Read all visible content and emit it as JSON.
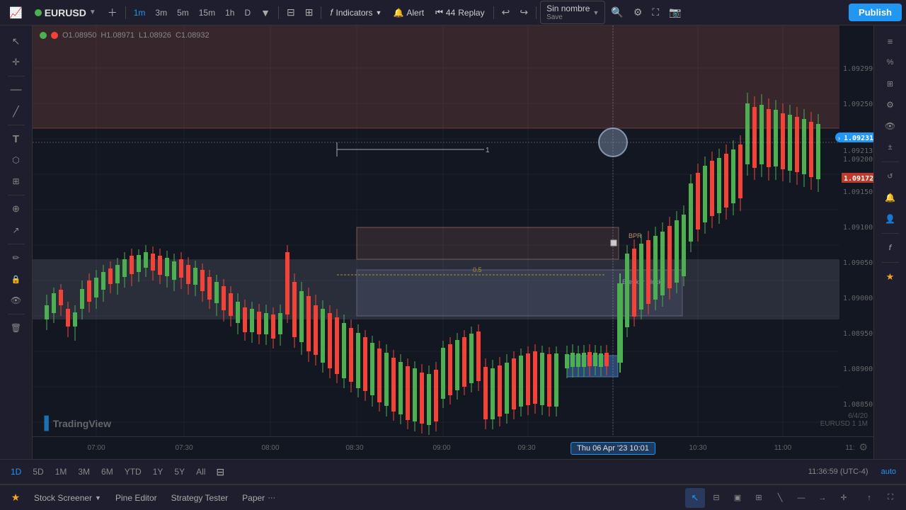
{
  "header": {
    "symbol": "EURUSD",
    "timeframes": [
      "1m",
      "3m",
      "5m",
      "15m",
      "1h",
      "D"
    ],
    "active_timeframe": "1m",
    "indicators_label": "Indicators",
    "alert_label": "Alert",
    "replay_label": "Replay",
    "replay_count": "44",
    "publish_label": "Publish",
    "chart_name": "Sin nombre",
    "chart_save": "Save"
  },
  "ohlc": {
    "open": "O1.08950",
    "high": "H1.08971",
    "low": "L1.08926",
    "close": "C1.08932"
  },
  "price_levels": {
    "p1": "1.09299",
    "p2": "1.09250",
    "p3": "1.09231",
    "p4": "1.09213",
    "p5": "1.09200",
    "p6": "1.09172",
    "p7": "1.09150",
    "p8": "1.09100",
    "p9": "1.09050",
    "p10": "1.09000",
    "p11": "1.08950",
    "p12": "1.08900",
    "p13": "1.08850"
  },
  "current_price": "1.09231",
  "current_price2": "1.09172",
  "time_labels": [
    "07:00",
    "07:30",
    "08:00",
    "08:30",
    "09:00",
    "09:30",
    "10:30",
    "11:00",
    "11:"
  ],
  "highlighted_time": "Thu 06 Apr '23  10:01",
  "bottom_timeframes": [
    "1D",
    "5D",
    "1M",
    "3M",
    "6M",
    "YTD",
    "1Y",
    "5Y",
    "All"
  ],
  "time_display": "11:36:59 (UTC-4)",
  "auto_label": "auto",
  "chart_date": "6/4/20",
  "chart_pair": "EURUSD 1 1M",
  "bpr_label": "BPR",
  "breaker_label": "Breaker Block",
  "fib_label": "0.5",
  "level_label": "1",
  "left_tools": [
    {
      "name": "cursor",
      "icon": "↖"
    },
    {
      "name": "crosshair",
      "icon": "+"
    },
    {
      "name": "horizontal-line",
      "icon": "—"
    },
    {
      "name": "trend-line",
      "icon": "╱"
    },
    {
      "name": "text",
      "icon": "T"
    },
    {
      "name": "drawing",
      "icon": "⬡"
    },
    {
      "name": "measure",
      "icon": "⊞"
    },
    {
      "name": "zoom",
      "icon": "⊕"
    },
    {
      "name": "forecast",
      "icon": "↗"
    },
    {
      "name": "brush",
      "icon": "✏"
    },
    {
      "name": "lock",
      "icon": "🔒"
    },
    {
      "name": "eye",
      "icon": "👁"
    },
    {
      "name": "trash",
      "icon": "🗑"
    }
  ],
  "right_tools": [
    {
      "name": "bars",
      "icon": "≡"
    },
    {
      "name": "percent",
      "icon": "%"
    },
    {
      "name": "grid",
      "icon": "⊞"
    },
    {
      "name": "settings",
      "icon": "⚙"
    },
    {
      "name": "watch",
      "icon": "👁"
    },
    {
      "name": "compare",
      "icon": "±"
    },
    {
      "name": "replay2",
      "icon": "↺"
    },
    {
      "name": "alert2",
      "icon": "🔔"
    },
    {
      "name": "person",
      "icon": "👤"
    },
    {
      "name": "indicator2",
      "icon": "f"
    },
    {
      "name": "star2",
      "icon": "★"
    }
  ],
  "status_bar": {
    "stock_screener": "Stock Screener",
    "pine_editor": "Pine Editor",
    "strategy_tester": "Strategy Tester",
    "paper": "Paper"
  },
  "drawing_tools_bottom": [
    "cursor",
    "bar-pattern",
    "box",
    "measure2",
    "line",
    "h-line",
    "ray",
    "cross"
  ]
}
